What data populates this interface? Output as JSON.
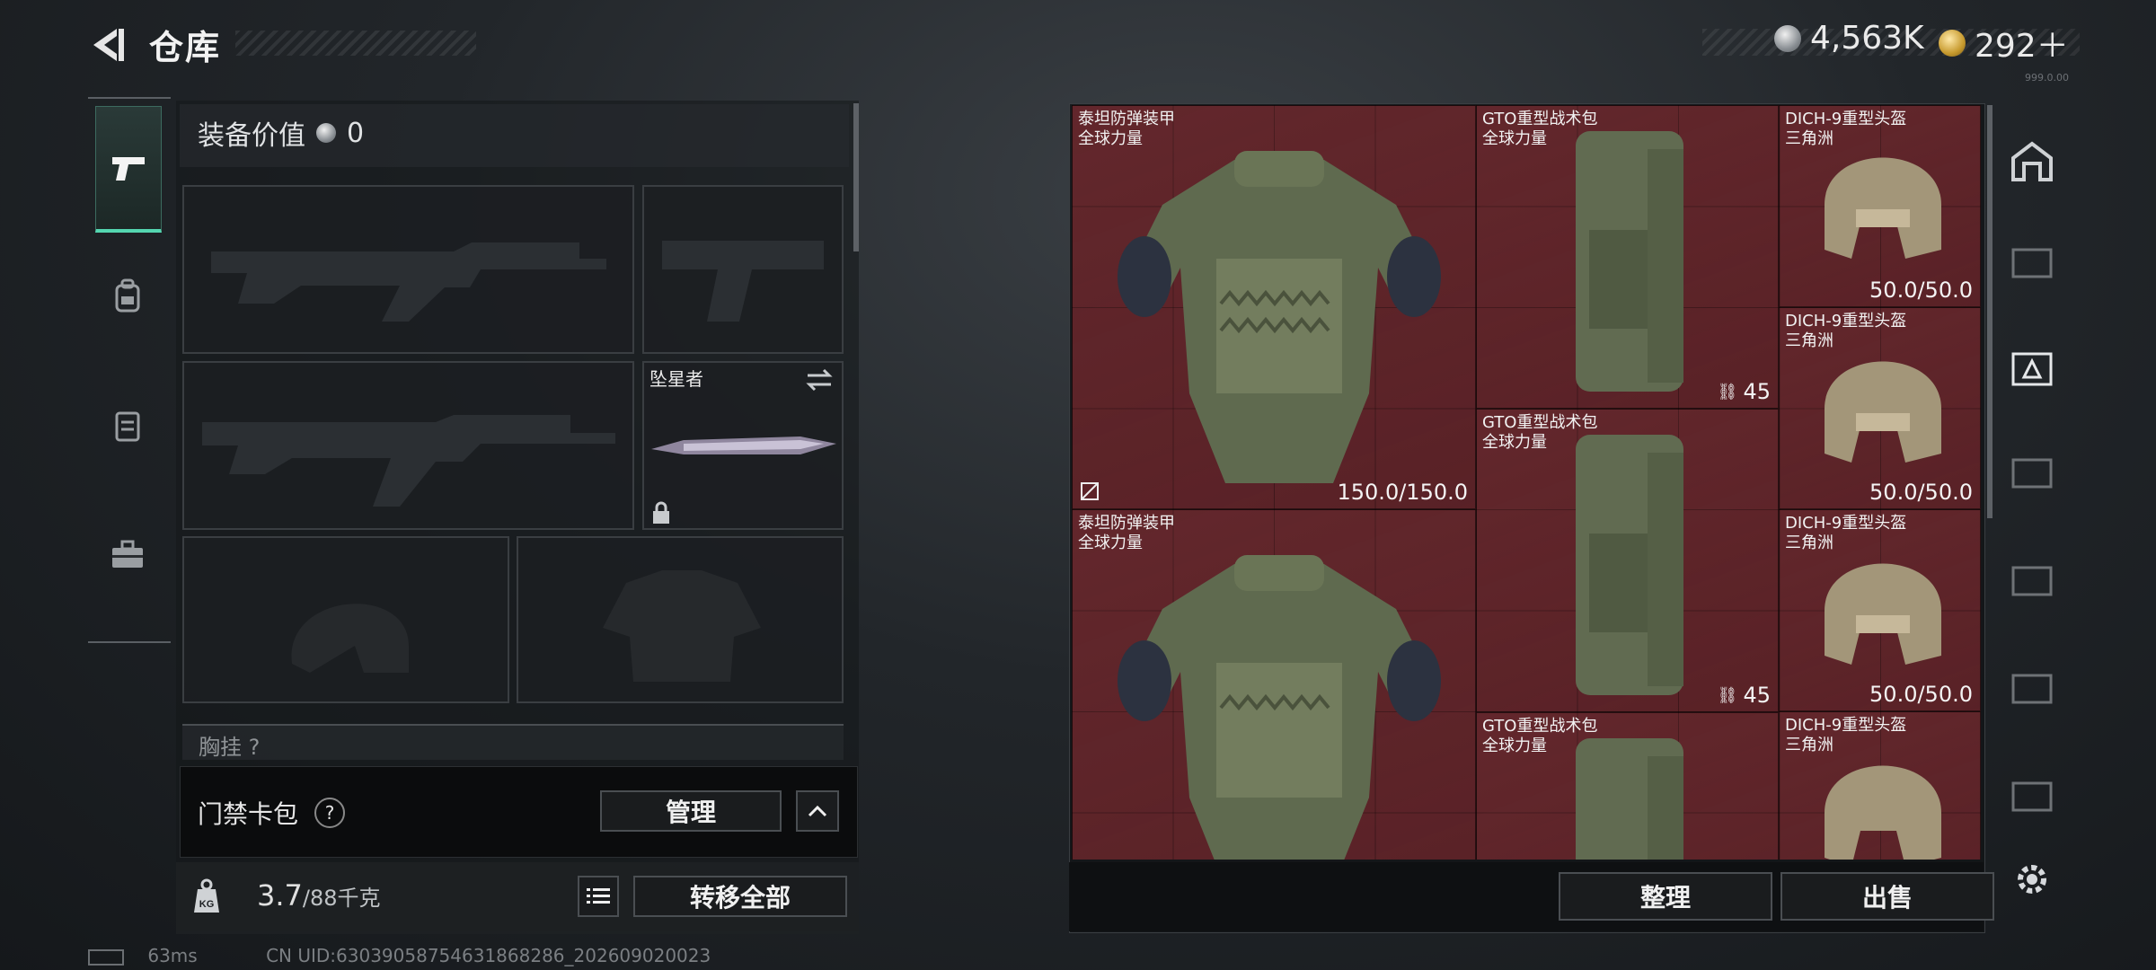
{
  "header": {
    "title": "仓库"
  },
  "currency": {
    "silver": "4,563K",
    "gold": "292＋",
    "tag": "999.0.00"
  },
  "loadout": {
    "value_label": "装备价值",
    "value": "0",
    "melee_name": "坠星者",
    "chest_label": "胸挂",
    "chest_hint": "?"
  },
  "keycard": {
    "label": "门禁卡包",
    "help": "?",
    "manage": "管理"
  },
  "capacity": {
    "current": "3.7",
    "max": "/88千克",
    "transfer": "转移全部",
    "kg": "KG"
  },
  "status": {
    "ping": "63ms",
    "uid": "CN UID:6303905875463186828​6_202609020023"
  },
  "storage": {
    "items": [
      {
        "name": "泰坦防弹装甲",
        "sub": "全球力量",
        "durability": "150.0/150.0"
      },
      {
        "name": "GTO重型战术包",
        "sub": "全球力量",
        "capacity": "45"
      },
      {
        "name": "DICH-9重型头盔",
        "sub": "三角洲",
        "durability": "50.0/50.0"
      },
      {
        "name": "DICH-9重型头盔",
        "sub": "三角洲",
        "durability": "50.0/50.0"
      },
      {
        "name": "GTO重型战术包",
        "sub": "全球力量",
        "capacity": "45"
      },
      {
        "name": "泰坦防弹装甲",
        "sub": "全球力量",
        "durability": ""
      },
      {
        "name": "DICH-9重型头盔",
        "sub": "三角洲",
        "durability": "50.0/50.0"
      },
      {
        "name": "GTO重型战术包",
        "sub": "全球力量",
        "capacity": ""
      },
      {
        "name": "DICH-9重型头盔",
        "sub": "三角洲",
        "durability": ""
      }
    ],
    "sort": "整理",
    "sell": "出售"
  }
}
